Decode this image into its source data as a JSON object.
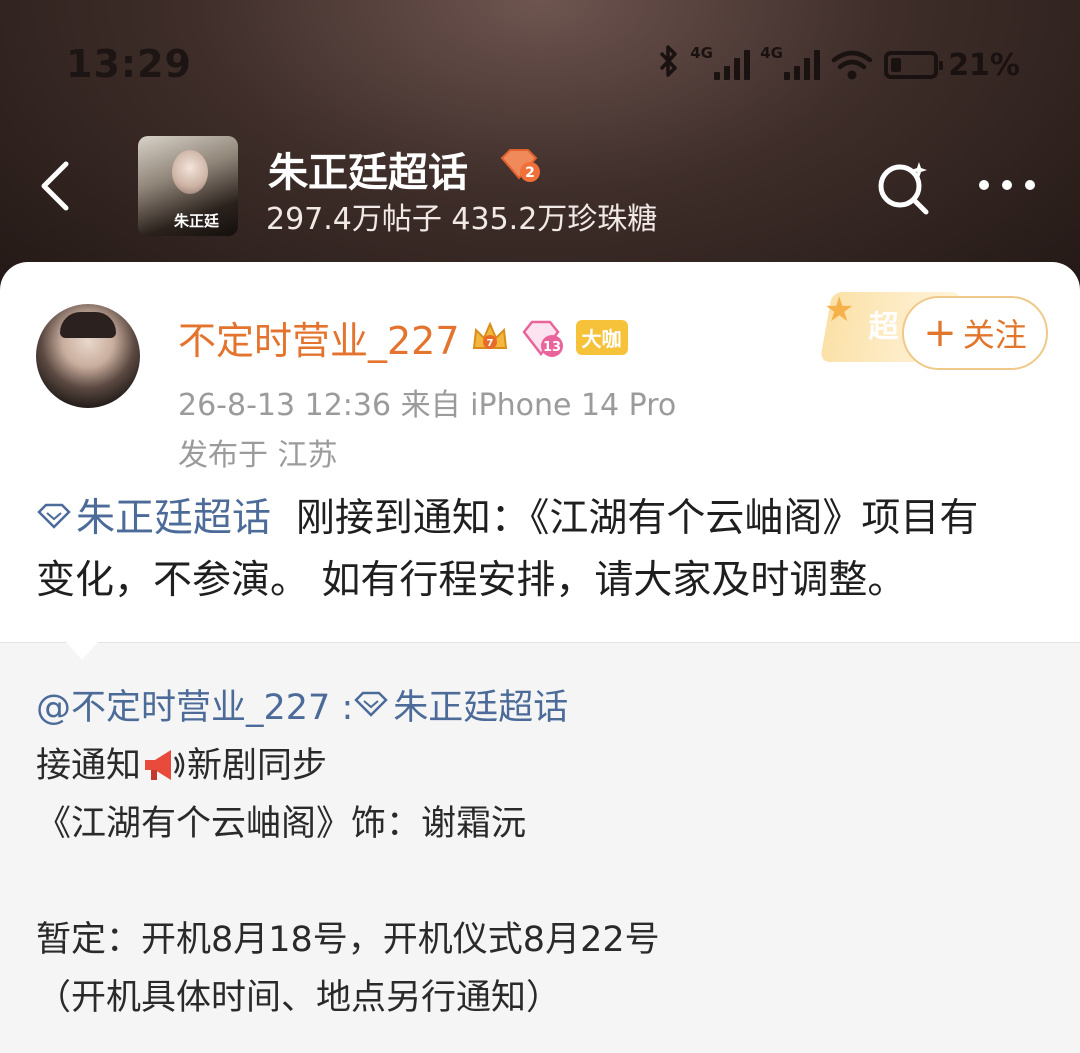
{
  "status_bar": {
    "time": "13:29",
    "network_1": "4G",
    "network_2": "4G",
    "battery": "21%"
  },
  "nav": {
    "topic_title": "朱正廷超话",
    "topic_level_badge": "2",
    "topic_stats": "297.4万帖子 435.2万珍珠糖",
    "cover_text": "朱正廷",
    "icons": [
      "back-icon",
      "search-icon",
      "more-icon"
    ]
  },
  "post": {
    "username": "不定时营业_227",
    "crown_level": "7",
    "fan_level": "13",
    "daka_label": "大咖",
    "meta": "26-8-13 12:36   来自 iPhone 14 Pro",
    "location": "发布于 江苏",
    "chao_label": "超",
    "follow_label": "关注",
    "topic_link": "朱正廷超话",
    "text_line1": "刚接到通知：《江湖有个云岫阁》项目有",
    "text_line2": "变化，不参演。 如有行程安排，请大家及时调整。"
  },
  "repost": {
    "author": "@不定时营业_227",
    "author_topic": "朱正廷超话",
    "line1_a": "接通知",
    "line1_b": "新剧同步",
    "line2": "《江湖有个云岫阁》饰：谢霜沅",
    "line4": "暂定：开机8月18号，开机仪式8月22号",
    "line5": "（开机具体时间、地点另行通知）"
  },
  "colors": {
    "username": "#e3732d",
    "link": "#4c6b99",
    "meta": "#9b9b9b"
  }
}
